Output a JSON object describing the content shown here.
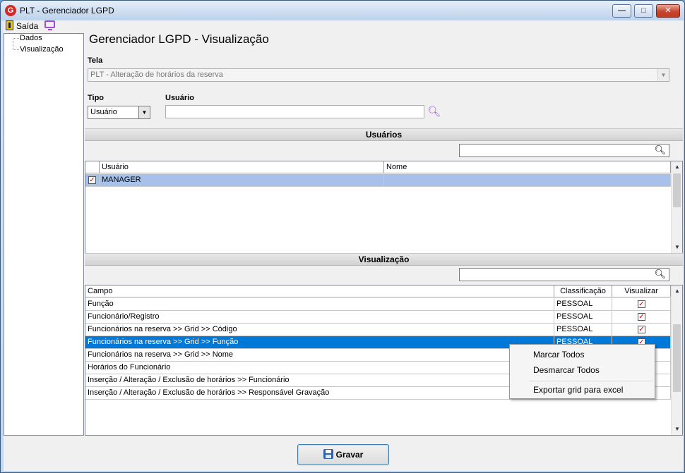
{
  "window": {
    "title": "PLT - Gerenciador LGPD",
    "logo_letter": "G",
    "minimize_glyph": "—",
    "maximize_glyph": "□",
    "close_glyph": "✕"
  },
  "menu": {
    "exit_label": "Saída"
  },
  "tree": {
    "items": [
      "Dados",
      "Visualização"
    ]
  },
  "page_title": "Gerenciador LGPD - Visualização",
  "tela": {
    "label": "Tela",
    "value": "PLT - Alteração de horários da reserva"
  },
  "tipo": {
    "label": "Tipo",
    "value": "Usuário"
  },
  "usuario": {
    "label": "Usuário",
    "value": ""
  },
  "usuarios_section": {
    "header": "Usuários",
    "filter_value": "",
    "columns": [
      "Usuário",
      "Nome"
    ],
    "rows": [
      {
        "checked": true,
        "usuario": "MANAGER",
        "nome": ""
      }
    ]
  },
  "visualizacao_section": {
    "header": "Visualização",
    "filter_value": "",
    "columns": [
      "Campo",
      "Classificação",
      "Visualizar"
    ],
    "rows": [
      {
        "campo": "Função",
        "classificacao": "PESSOAL",
        "visualizar": true
      },
      {
        "campo": "Funcionário/Registro",
        "classificacao": "PESSOAL",
        "visualizar": true
      },
      {
        "campo": "Funcionários na reserva >> Grid >> Código",
        "classificacao": "PESSOAL",
        "visualizar": true
      },
      {
        "campo": "Funcionários na reserva >> Grid >> Função",
        "classificacao": "PESSOAL",
        "visualizar": true
      },
      {
        "campo": "Funcionários na reserva >> Grid >> Nome",
        "classificacao": "",
        "visualizar": null
      },
      {
        "campo": "Horários do Funcionário",
        "classificacao": "",
        "visualizar": null
      },
      {
        "campo": "Inserção / Alteração / Exclusão de horários >> Funcionário",
        "classificacao": "",
        "visualizar": null
      },
      {
        "campo": "Inserção / Alteração / Exclusão de horários >> Responsável Gravação",
        "classificacao": "",
        "visualizar": null
      }
    ],
    "selected_row_index": 3
  },
  "context_menu": {
    "items": [
      "Marcar Todos",
      "Desmarcar Todos",
      "Exportar grid para excel"
    ]
  },
  "save_button": {
    "label": "Gravar"
  },
  "colors": {
    "selection": "#0078d7",
    "user_row_selection": "#a7c1e8",
    "check_mark": "#d00000",
    "search_icon": "#a05ad8"
  },
  "icons": {
    "exit": "door-exit-icon",
    "monitor": "monitor-icon",
    "search": "magnifier-icon",
    "save": "floppy-disk-icon"
  }
}
